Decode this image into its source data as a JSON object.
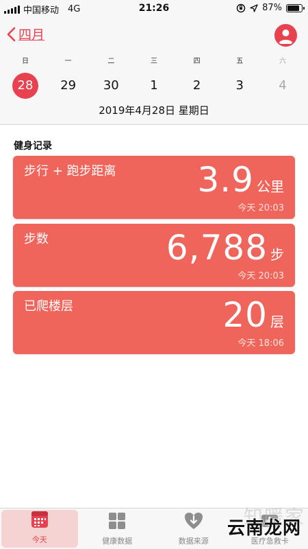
{
  "status_bar": {
    "carrier": "中国移动",
    "network": "4G",
    "time": "21:26",
    "battery": "87%",
    "battery_level": 0.87
  },
  "header": {
    "back_label": "四月",
    "weekdays": [
      "日",
      "一",
      "二",
      "三",
      "四",
      "五",
      "六"
    ],
    "dates": [
      "28",
      "29",
      "30",
      "1",
      "2",
      "3",
      "4"
    ],
    "full_date": "2019年4月28日 星期日"
  },
  "section": {
    "title": "健身记录"
  },
  "cards": [
    {
      "title": "步行 + 跑步距离",
      "value": "3.9",
      "unit": "公里",
      "time": "今天 20:03"
    },
    {
      "title": "步数",
      "value": "6,788",
      "unit": "步",
      "time": "今天 20:03"
    },
    {
      "title": "已爬楼层",
      "value": "20",
      "unit": "层",
      "time": "今天 18:06"
    }
  ],
  "tabs": [
    {
      "label": "今天",
      "icon": "calendar-icon"
    },
    {
      "label": "健康数据",
      "icon": "grid-icon"
    },
    {
      "label": "数据来源",
      "icon": "download-heart-icon"
    },
    {
      "label": "医疗急救卡",
      "icon": "medical-id-icon"
    }
  ],
  "watermark": {
    "main": "云南龙网",
    "ghost": "知暖家"
  },
  "colors": {
    "accent": "#e8414f",
    "card": "#f0655b"
  }
}
